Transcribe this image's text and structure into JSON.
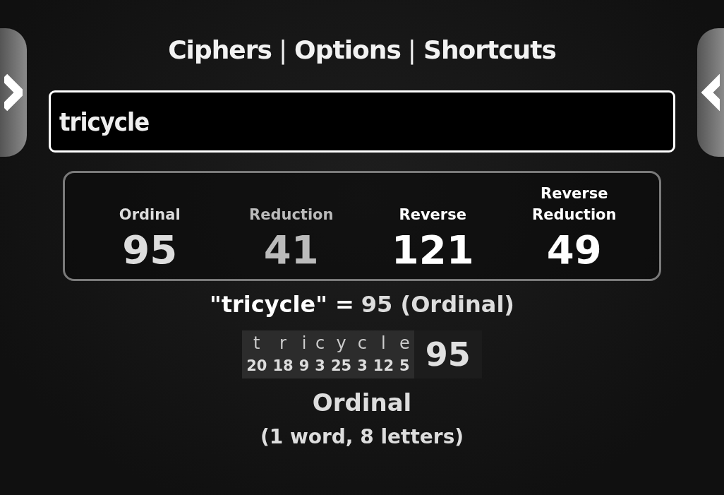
{
  "nav": [
    {
      "kind": "link",
      "text": "Ciphers"
    },
    {
      "kind": "separator",
      "text": "|"
    },
    {
      "kind": "link",
      "text": "Options"
    },
    {
      "kind": "separator",
      "text": "|"
    },
    {
      "kind": "link",
      "text": "Shortcuts"
    }
  ],
  "search": {
    "value": "tricycle"
  },
  "ciphers": [
    {
      "label": "Ordinal",
      "value": "95",
      "color": "#dddddd"
    },
    {
      "label": "Reduction",
      "value": "41",
      "color": "#bbbbbb"
    },
    {
      "label": "Reverse",
      "value": "121",
      "color": "#ffffff"
    },
    {
      "label": "Reverse Reduction",
      "value": "49",
      "color": "#ffffff"
    }
  ],
  "result": {
    "phrase": "\"tricycle\" =",
    "value": "95 (Ordinal)"
  },
  "breakdown": {
    "letters": [
      {
        "letter": "t",
        "value": "20"
      },
      {
        "letter": "r",
        "value": "18"
      },
      {
        "letter": "i",
        "value": "9"
      },
      {
        "letter": "c",
        "value": "3"
      },
      {
        "letter": "y",
        "value": "25"
      },
      {
        "letter": "c",
        "value": "3"
      },
      {
        "letter": "l",
        "value": "12"
      },
      {
        "letter": "e",
        "value": "5"
      }
    ],
    "total": "95"
  },
  "cipher_name": "Ordinal",
  "summary": "(1 word, 8 letters)"
}
